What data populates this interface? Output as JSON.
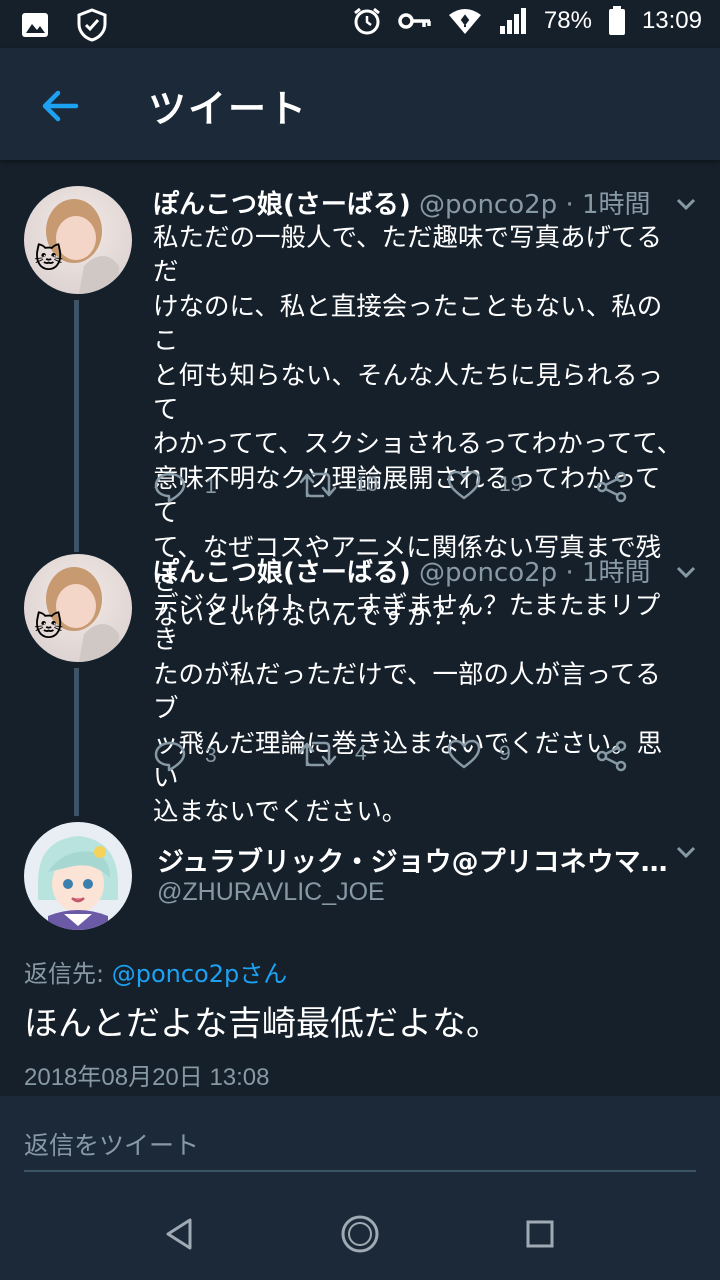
{
  "status_bar": {
    "battery": "78%",
    "time": "13:09",
    "icons": [
      "image-icon",
      "shield-check-icon",
      "alarm-icon",
      "key-icon",
      "wifi-icon",
      "signal-icon",
      "battery-icon"
    ]
  },
  "header": {
    "title": "ツイート",
    "back_icon": "back-arrow-icon"
  },
  "tweets": [
    {
      "name": "ぽんこつ娘(さーばる)",
      "handle": "@ponco2p",
      "time": "· 1時間",
      "lines": [
        "私ただの一般人で、ただ趣味で写真あげてるだ",
        "けなのに、私と直接会ったこともない、私のこ",
        "と何も知らない、そんな人たちに見られるって",
        "わかってて、スクショされるってわかってて、",
        "意味不明なクソ理論展開されるってわかってて",
        "て、なぜコスやアニメに関係ない写真まで残さ",
        "ないといけないんですか？？"
      ],
      "replies": "1",
      "retweets": "10",
      "likes": "19"
    },
    {
      "name": "ぽんこつ娘(さーばる)",
      "handle": "@ponco2p",
      "time": "· 1時間",
      "lines": [
        "デジタルタトゥーすぎません？たまたまリプき",
        "たのが私だっただけで、一部の人が言ってるブ",
        "ッ飛んだ理論に巻き込まないでください。思い",
        "込まないでください。"
      ],
      "replies": "3",
      "retweets": "4",
      "likes": "9"
    }
  ],
  "main_tweet": {
    "name": "ジュラブリック・ジョウ@プリコネウマ…",
    "handle": "@ZHURAVLIC_JOE",
    "reply_label": "返信先: ",
    "reply_mention": "@ponco2pさん",
    "text": "ほんとだよな吉崎最低だよな。",
    "timestamp": "2018年08月20日 13:08"
  },
  "reply_bar": {
    "placeholder": "返信をツイート"
  },
  "colors": {
    "background": "#15202b",
    "header": "#1c2938",
    "accent": "#1da1f2",
    "muted": "#8899a6"
  }
}
